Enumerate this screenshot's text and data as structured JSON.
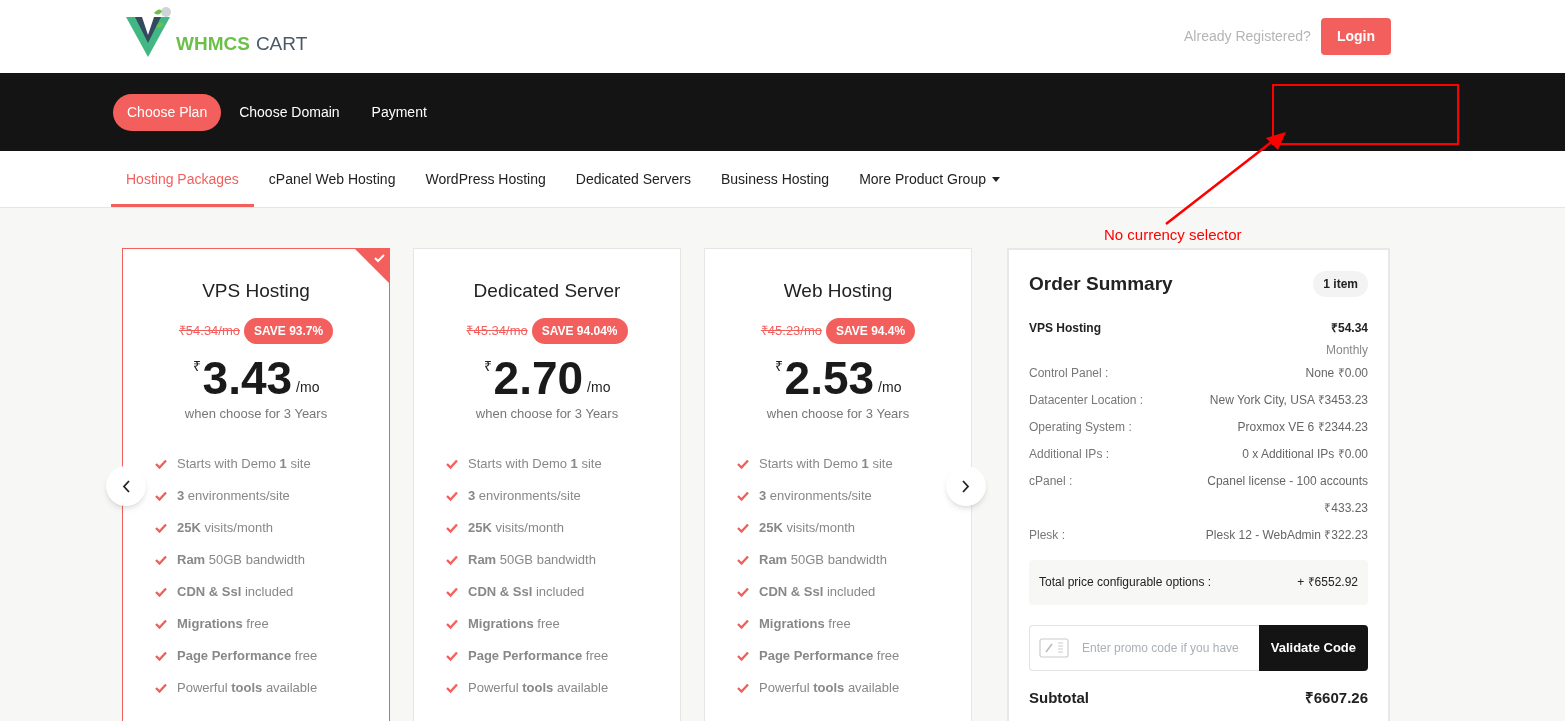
{
  "header": {
    "logo": {
      "part_1": "WHMCS",
      "part_2": "CART"
    },
    "already_registered": "Already Registered?",
    "login_button": "Login"
  },
  "steps": [
    {
      "label": "Choose Plan",
      "selected": true
    },
    {
      "label": "Choose Domain",
      "selected": false
    },
    {
      "label": "Payment",
      "selected": false
    }
  ],
  "product_groups": [
    {
      "label": "Hosting Packages",
      "selected": true
    },
    {
      "label": "cPanel Web Hosting",
      "selected": false
    },
    {
      "label": "WordPress Hosting",
      "selected": false
    },
    {
      "label": "Dedicated Servers",
      "selected": false
    },
    {
      "label": "Business Hosting",
      "selected": false
    },
    {
      "label": "More Product Group",
      "selected": false,
      "dropdown": true
    }
  ],
  "annotation": {
    "text": "No currency selector"
  },
  "plans": [
    {
      "name": "VPS Hosting",
      "old_price": "₹54.34/mo",
      "save": "SAVE 93.7%",
      "currency": "₹",
      "price": "3.43",
      "period": "/mo",
      "term": "when choose for 3 Years",
      "selected": true,
      "features": [
        "Starts with Demo **1** site",
        "**3** environments/site",
        "**25K** visits/month",
        "**Ram** 50GB bandwidth",
        "**CDN & Ssl** included",
        "**Migrations** free",
        "**Page Performance** free",
        "Powerful **tools** available"
      ]
    },
    {
      "name": "Dedicated Server",
      "old_price": "₹45.34/mo",
      "save": "SAVE 94.04%",
      "currency": "₹",
      "price": "2.70",
      "period": "/mo",
      "term": "when choose for 3 Years",
      "selected": false,
      "features": [
        "Starts with Demo **1** site",
        "**3** environments/site",
        "**25K** visits/month",
        "**Ram** 50GB bandwidth",
        "**CDN & Ssl** included",
        "**Migrations** free",
        "**Page Performance** free",
        "Powerful **tools** available"
      ]
    },
    {
      "name": "Web Hosting",
      "old_price": "₹45.23/mo",
      "save": "SAVE 94.4%",
      "currency": "₹",
      "price": "2.53",
      "period": "/mo",
      "term": "when choose for 3 Years",
      "selected": false,
      "features": [
        "Starts with Demo **1** site",
        "**3** environments/site",
        "**25K** visits/month",
        "**Ram** 50GB bandwidth",
        "**CDN & Ssl** included",
        "**Migrations** free",
        "**Page Performance** free",
        "Powerful **tools** available"
      ]
    }
  ],
  "order_summary": {
    "title": "Order Summary",
    "item_count": "1 item",
    "product": "VPS Hosting",
    "product_price": "₹54.34",
    "billing_cycle": "Monthly",
    "options": [
      {
        "label": "Control Panel :",
        "value": "None ₹0.00"
      },
      {
        "label": "Datacenter Location :",
        "value": "New York City, USA ₹3453.23"
      },
      {
        "label": "Operating System :",
        "value": "Proxmox VE 6 ₹2344.23"
      },
      {
        "label": "Additional IPs :",
        "value": "0 x Additional IPs ₹0.00"
      },
      {
        "label": "cPanel :",
        "value": "Cpanel license - 100 accounts ₹433.23"
      },
      {
        "label": "Plesk :",
        "value": "Plesk 12 - WebAdmin ₹322.23"
      }
    ],
    "total_options_label": "Total price configurable options :",
    "total_options_value": "+ ₹6552.92",
    "promo_placeholder": "Enter promo code if you have",
    "validate_button": "Validate Code",
    "subtotal_label": "Subtotal",
    "subtotal_value": "₹6607.26"
  }
}
